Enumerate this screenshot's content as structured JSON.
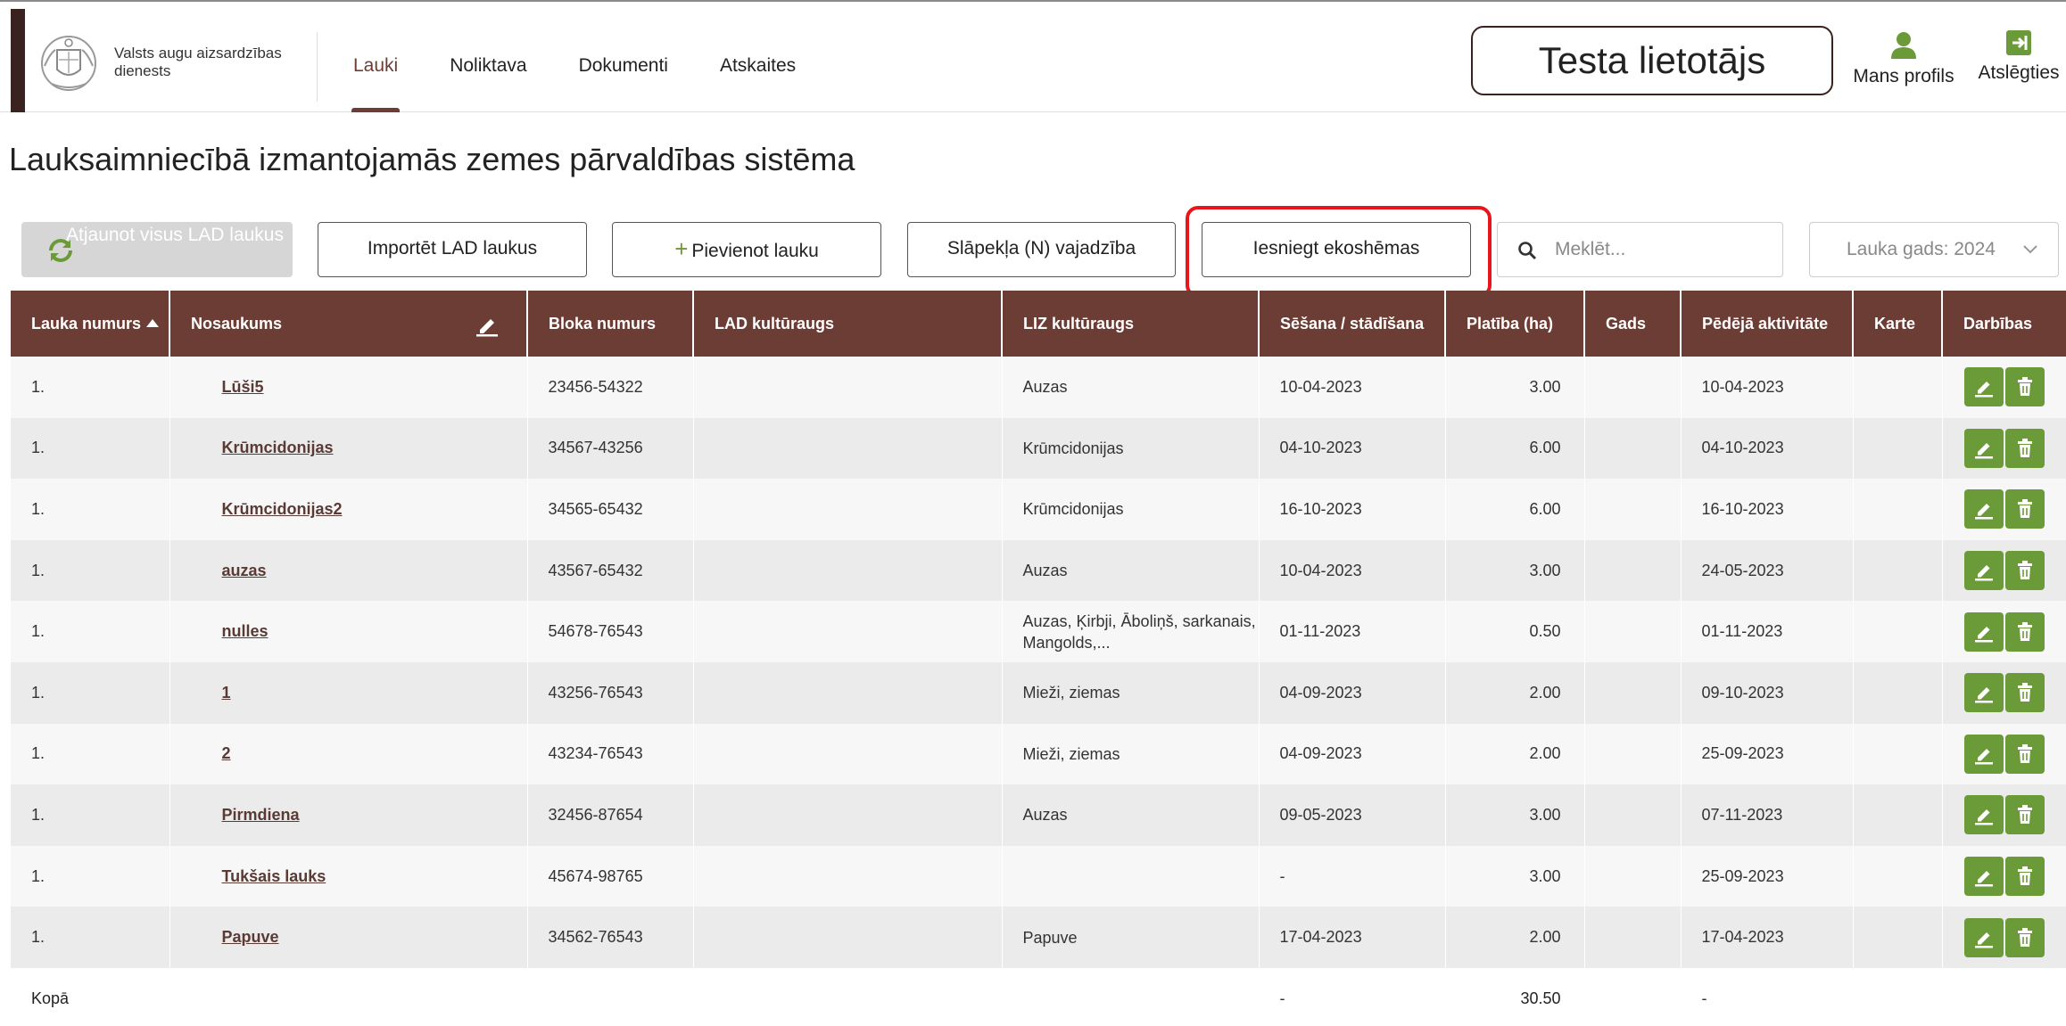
{
  "header": {
    "org_name": "Valsts augu aizsardzības dienests",
    "nav": [
      "Lauki",
      "Noliktava",
      "Dokumenti",
      "Atskaites"
    ],
    "active_nav": "Lauki",
    "user_name": "Testa lietotājs",
    "profile_label": "Mans profils",
    "logout_label": "Atslēgties"
  },
  "page": {
    "title": "Lauksaimniecībā izmantojamās zemes pārvaldības sistēma"
  },
  "toolbar": {
    "refresh_label": "Atjaunot visus LAD laukus",
    "import_label": "Importēt LAD laukus",
    "add_label": "Pievienot lauku",
    "nitrogen_label": "Slāpekļa (N) vajadzība",
    "eco_label": "Iesniegt ekoshēmas",
    "search_placeholder": "Meklēt...",
    "year_label": "Lauka gads: 2024"
  },
  "colors": {
    "header_bg": "#6b3d35",
    "action_green": "#6b9a38",
    "highlight_red": "#e8161b",
    "brand_dark": "#3a2220"
  },
  "table": {
    "columns": [
      "Lauka numurs",
      "Nosaukums",
      "Bloka numurs",
      "LAD kultūraugs",
      "LIZ kultūraugs",
      "Sēšana / stādīšana",
      "Platība (ha)",
      "Gads",
      "Pēdējā aktivitāte",
      "Karte",
      "Darbības"
    ],
    "rows": [
      {
        "num": "1.",
        "name": "Lūši5",
        "block": "23456-54322",
        "lad": "",
        "liz": "Auzas",
        "sowing": "10-04-2023",
        "area": "3.00",
        "year": "",
        "last": "10-04-2023",
        "map": ""
      },
      {
        "num": "1.",
        "name": "Krūmcidonijas",
        "block": "34567-43256",
        "lad": "",
        "liz": "Krūmcidonijas",
        "sowing": "04-10-2023",
        "area": "6.00",
        "year": "",
        "last": "04-10-2023",
        "map": ""
      },
      {
        "num": "1.",
        "name": "Krūmcidonijas2",
        "block": "34565-65432",
        "lad": "",
        "liz": "Krūmcidonijas",
        "sowing": "16-10-2023",
        "area": "6.00",
        "year": "",
        "last": "16-10-2023",
        "map": ""
      },
      {
        "num": "1.",
        "name": "auzas",
        "block": "43567-65432",
        "lad": "",
        "liz": "Auzas",
        "sowing": "10-04-2023",
        "area": "3.00",
        "year": "",
        "last": "24-05-2023",
        "map": ""
      },
      {
        "num": "1.",
        "name": "nulles",
        "block": "54678-76543",
        "lad": "",
        "liz": "Auzas, Ķirbji, Āboliņš, sarkanais, Mangolds,...",
        "sowing": "01-11-2023",
        "area": "0.50",
        "year": "",
        "last": "01-11-2023",
        "map": ""
      },
      {
        "num": "1.",
        "name": "1",
        "block": "43256-76543",
        "lad": "",
        "liz": "Mieži, ziemas",
        "sowing": "04-09-2023",
        "area": "2.00",
        "year": "",
        "last": "09-10-2023",
        "map": ""
      },
      {
        "num": "1.",
        "name": "2",
        "block": "43234-76543",
        "lad": "",
        "liz": "Mieži, ziemas",
        "sowing": "04-09-2023",
        "area": "2.00",
        "year": "",
        "last": "25-09-2023",
        "map": ""
      },
      {
        "num": "1.",
        "name": "Pirmdiena",
        "block": "32456-87654",
        "lad": "",
        "liz": "Auzas",
        "sowing": "09-05-2023",
        "area": "3.00",
        "year": "",
        "last": "07-11-2023",
        "map": ""
      },
      {
        "num": "1.",
        "name": "Tukšais lauks",
        "block": "45674-98765",
        "lad": "",
        "liz": "",
        "sowing": "-",
        "area": "3.00",
        "year": "",
        "last": "25-09-2023",
        "map": ""
      },
      {
        "num": "1.",
        "name": "Papuve",
        "block": "34562-76543",
        "lad": "",
        "liz": "Papuve",
        "sowing": "17-04-2023",
        "area": "2.00",
        "year": "",
        "last": "17-04-2023",
        "map": ""
      }
    ],
    "total": {
      "label": "Kopā",
      "sowing": "-",
      "area": "30.50",
      "last": "-"
    }
  }
}
